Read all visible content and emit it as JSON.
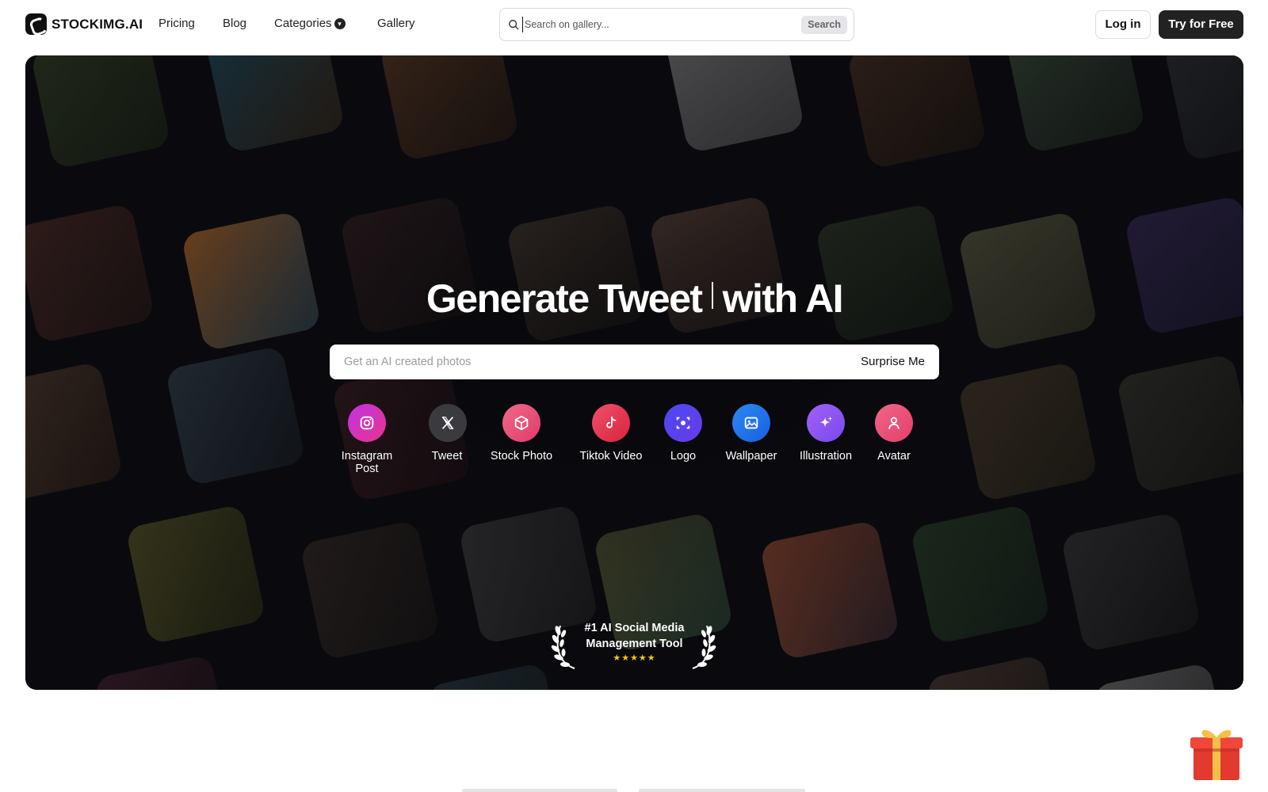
{
  "brand": {
    "name": "STOCKIMG.AI"
  },
  "nav": {
    "links": [
      "Pricing",
      "Blog",
      "Categories",
      "Gallery"
    ],
    "search": {
      "placeholder": "Search on gallery...",
      "button": "Search"
    },
    "login": "Log in",
    "cta": "Try for Free"
  },
  "hero": {
    "headline_prefix": "Generate Tweet",
    "headline_suffix": "with AI",
    "prompt_placeholder": "Get an AI created photos",
    "surprise": "Surprise Me",
    "categories": [
      {
        "label": "Instagram Post",
        "icon": "instagram-icon",
        "color": "#d62fd0"
      },
      {
        "label": "Tweet",
        "icon": "x-icon",
        "color": "#3b3b3f"
      },
      {
        "label": "Stock Photo",
        "icon": "box-icon",
        "color": "#ec4f7f"
      },
      {
        "label": "Tiktok Video",
        "icon": "tiktok-icon",
        "color": "#e8344f"
      },
      {
        "label": "Logo",
        "icon": "logo-scan-icon",
        "color": "#5b3df0"
      },
      {
        "label": "Wallpaper",
        "icon": "image-icon",
        "color": "#1e7bf0"
      },
      {
        "label": "Illustration",
        "icon": "sparkle-icon",
        "color": "#9a52f0"
      },
      {
        "label": "Avatar",
        "icon": "user-icon",
        "color": "#ee4d78"
      }
    ],
    "award": {
      "line1": "#1 AI Social Media",
      "line2": "Management Tool",
      "stars": "★★★★★"
    }
  }
}
